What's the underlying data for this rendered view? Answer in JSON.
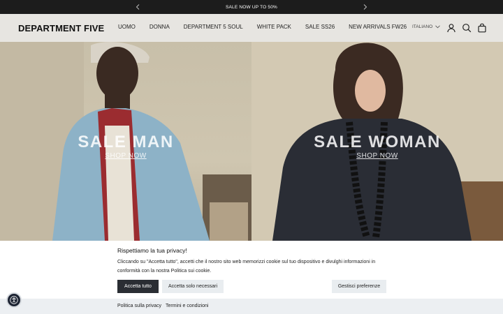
{
  "announcement": {
    "text": "SALE NOW UP TO 50%"
  },
  "header": {
    "logo": "DEPARTMENT FIVE",
    "nav": [
      "UOMO",
      "DONNA",
      "DEPARTMENT 5 SOUL",
      "WHITE PACK",
      "SALE SS26",
      "NEW ARRIVALS FW26"
    ],
    "language": "ITALIANO",
    "icons": [
      "account-icon",
      "search-icon",
      "cart-icon"
    ]
  },
  "hero": {
    "left": {
      "title": "SALE MAN",
      "cta": "SHOP NOW"
    },
    "right": {
      "title": "SALE WOMAN",
      "cta": "SHOP NOW"
    }
  },
  "cookie": {
    "title": "Rispettiamo la tua privacy!",
    "text": "Cliccando su \"Accetta tutto\", accetti che il nostro sito web memorizzi cookie sul tuo dispositivo e divulghi informazioni in conformità con la nostra Politica sui cookie.",
    "accept_all": "Accetta tutto",
    "accept_necessary": "Accetta solo necessari",
    "manage": "Gestisci preferenze",
    "privacy_link": "Politica sulla privacy",
    "terms_link": "Termini e condizioni"
  },
  "colors": {
    "announce_bg": "#1c1c1c",
    "header_bg": "#e7e5e1",
    "accept_bg": "#2a2d33",
    "secondary_btn_bg": "#e9edf0"
  }
}
